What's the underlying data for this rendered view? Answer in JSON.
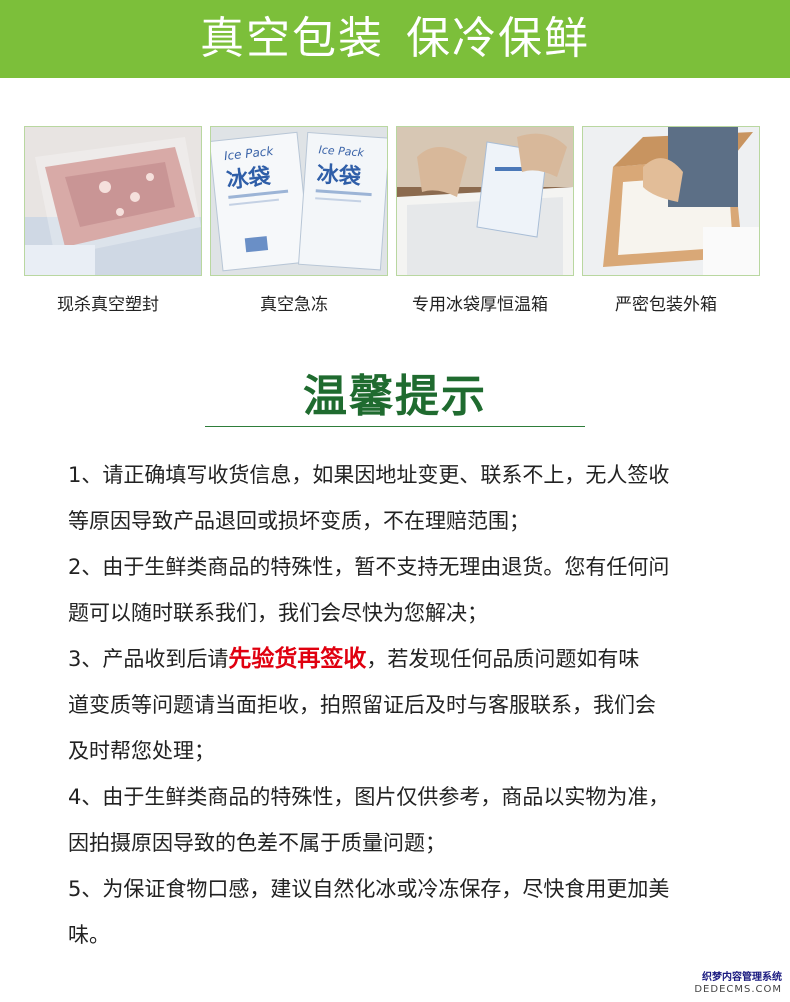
{
  "banner": {
    "part1": "真空包装",
    "part2": "保冷保鲜"
  },
  "photos": [
    {
      "caption": "现杀真空塑封",
      "icon": "vacuum-sealed-meat-photo"
    },
    {
      "caption": "真空急冻",
      "icon": "ice-pack-photo",
      "pack_text": "冰袋",
      "pack_brand": "Ice Pack"
    },
    {
      "caption": "专用冰袋厚恒温箱",
      "icon": "insulated-box-photo"
    },
    {
      "caption": "严密包装外箱",
      "icon": "outer-carton-photo"
    }
  ],
  "tips": {
    "title": "温馨提示",
    "lines": [
      {
        "text": "1、请正确填写收货信息，如果因地址变更、联系不上，无人签收"
      },
      {
        "text": "等原因导致产品退回或损坏变质，不在理赔范围；"
      },
      {
        "text": "2、由于生鲜类商品的特殊性，暂不支持无理由退货。您有任何问"
      },
      {
        "text": "题可以随时联系我们，我们会尽快为您解决；"
      },
      {
        "pre": "3、产品收到后请",
        "highlight": "先验货再签收",
        "post": "，若发现任何品质问题如有味"
      },
      {
        "text": "道变质等问题请当面拒收，拍照留证后及时与客服联系，我们会"
      },
      {
        "text": "及时帮您处理；"
      },
      {
        "text": "4、由于生鲜类商品的特殊性，图片仅供参考，商品以实物为准，"
      },
      {
        "text": "因拍摄原因导致的色差不属于质量问题；"
      },
      {
        "text": "5、为保证食物口感，建议自然化冰或冷冻保存，尽快食用更加美"
      },
      {
        "text": "味。"
      }
    ]
  },
  "watermark": {
    "line1": "织梦内容管理系统",
    "line2": "DEDECMS.COM"
  },
  "colors": {
    "banner": "#7cbf3a",
    "title": "#1f6b2f",
    "highlight": "#e0000f"
  }
}
